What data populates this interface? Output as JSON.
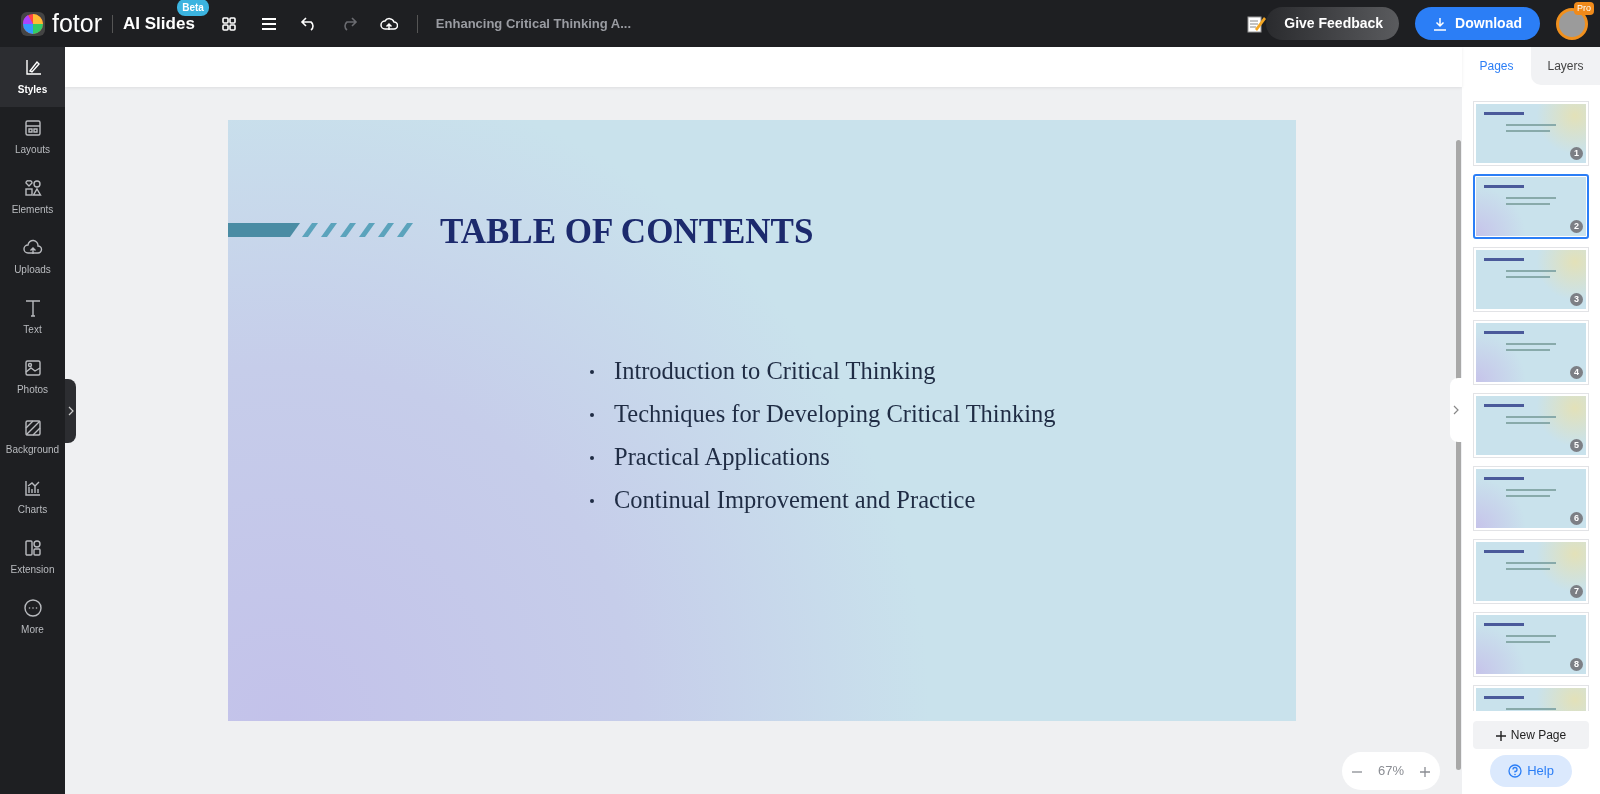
{
  "app": {
    "logo": "fotor",
    "product": "AI Slides",
    "product_badge": "Beta",
    "doc_title": "Enhancing Critical Thinking A..."
  },
  "toolbar": {
    "redo_disabled": true
  },
  "header_actions": {
    "feedback": "Give Feedback",
    "download": "Download",
    "avatar_badge": "Pro"
  },
  "sidebar": {
    "items": [
      {
        "label": "Styles",
        "selected": true
      },
      {
        "label": "Layouts",
        "selected": false
      },
      {
        "label": "Elements",
        "selected": false
      },
      {
        "label": "Uploads",
        "selected": false
      },
      {
        "label": "Text",
        "selected": false
      },
      {
        "label": "Photos",
        "selected": false
      },
      {
        "label": "Background",
        "selected": false
      },
      {
        "label": "Charts",
        "selected": false
      },
      {
        "label": "Extension",
        "selected": false
      },
      {
        "label": "More",
        "selected": false
      }
    ]
  },
  "slide": {
    "title": "TABLE OF CONTENTS",
    "bullets": [
      "Introduction to Critical Thinking",
      "Techniques for Developing Critical Thinking",
      "Practical Applications",
      "Continual Improvement and Practice"
    ]
  },
  "zoom": {
    "value": "67%"
  },
  "panel": {
    "tabs": [
      {
        "label": "Pages",
        "selected": true
      },
      {
        "label": "Layers",
        "selected": false
      }
    ],
    "pages": [
      {
        "number": "1",
        "selected": false
      },
      {
        "number": "2",
        "selected": true
      },
      {
        "number": "3",
        "selected": false
      },
      {
        "number": "4",
        "selected": false
      },
      {
        "number": "5",
        "selected": false
      },
      {
        "number": "6",
        "selected": false
      },
      {
        "number": "7",
        "selected": false
      },
      {
        "number": "8",
        "selected": false
      },
      {
        "selected": false
      }
    ],
    "new_page": "New Page",
    "help": "Help"
  }
}
